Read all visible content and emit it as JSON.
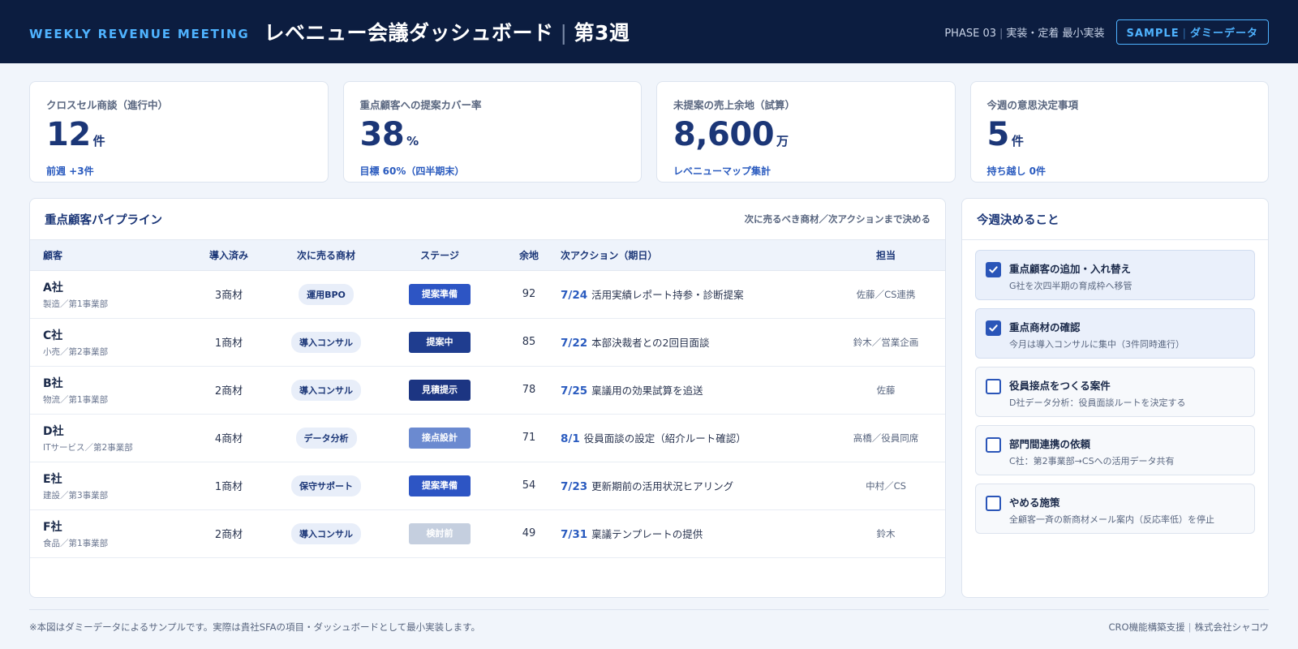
{
  "header": {
    "eyebrow": "WEEKLY REVENUE MEETING",
    "title": "レベニュー会議ダッシュボード",
    "week": "第3週",
    "phase": "PHASE 03",
    "phase_detail": "実装・定着 最小実装",
    "sample_label": "SAMPLE",
    "sample_detail": "ダミーデータ"
  },
  "kpis": [
    {
      "label": "クロスセル商談（進行中）",
      "value": "12",
      "unit": "件",
      "note": "前週 +3件"
    },
    {
      "label": "重点顧客への提案カバー率",
      "value": "38",
      "unit": "%",
      "note": "目標 60%（四半期末）"
    },
    {
      "label": "未提案の売上余地（試算）",
      "value": "8,600",
      "unit": "万",
      "note": "レベニューマップ集計"
    },
    {
      "label": "今週の意思決定事項",
      "value": "5",
      "unit": "件",
      "note": "持ち越し 0件"
    }
  ],
  "pipeline": {
    "title": "重点顧客パイプライン",
    "subtitle": "次に売るべき商材／次アクションまで決める",
    "columns": [
      "顧客",
      "導入済み",
      "次に売る商材",
      "ステージ",
      "余地",
      "次アクション（期日）",
      "担当"
    ],
    "rows": [
      {
        "name": "A社",
        "sub": "製造／第1事業部",
        "installed": "3商材",
        "product": "運用BPO",
        "stage": "提案準備",
        "stage_color": "#2d55c4",
        "score": "92",
        "date": "7/24",
        "action": "活用実績レポート持参・診断提案",
        "owner": "佐藤／CS連携"
      },
      {
        "name": "C社",
        "sub": "小売／第2事業部",
        "installed": "1商材",
        "product": "導入コンサル",
        "stage": "提案中",
        "stage_color": "#1f3d8f",
        "score": "85",
        "date": "7/22",
        "action": "本部決裁者との2回目面談",
        "owner": "鈴木／営業企画"
      },
      {
        "name": "B社",
        "sub": "物流／第1事業部",
        "installed": "2商材",
        "product": "導入コンサル",
        "stage": "見積提示",
        "stage_color": "#1c3582",
        "score": "78",
        "date": "7/25",
        "action": "稟議用の効果試算を追送",
        "owner": "佐藤"
      },
      {
        "name": "D社",
        "sub": "ITサービス／第2事業部",
        "installed": "4商材",
        "product": "データ分析",
        "stage": "接点設計",
        "stage_color": "#6b8ad0",
        "score": "71",
        "date": "8/1",
        "action": "役員面談の設定（紹介ルート確認）",
        "owner": "高橋／役員同席"
      },
      {
        "name": "E社",
        "sub": "建設／第3事業部",
        "installed": "1商材",
        "product": "保守サポート",
        "stage": "提案準備",
        "stage_color": "#2d55c4",
        "score": "54",
        "date": "7/23",
        "action": "更新期前の活用状況ヒアリング",
        "owner": "中村／CS"
      },
      {
        "name": "F社",
        "sub": "食品／第1事業部",
        "installed": "2商材",
        "product": "導入コンサル",
        "stage": "検討前",
        "stage_color": "#c5cfdf",
        "score": "49",
        "date": "7/31",
        "action": "稟議テンプレートの提供",
        "owner": "鈴木"
      }
    ]
  },
  "decisions": {
    "title": "今週決めること",
    "items": [
      {
        "title": "重点顧客の追加・入れ替え",
        "sub": "G社を次四半期の育成枠へ移管",
        "checked": true
      },
      {
        "title": "重点商材の確認",
        "sub": "今月は導入コンサルに集中（3件同時進行）",
        "checked": true
      },
      {
        "title": "役員接点をつくる案件",
        "sub": "D社データ分析：役員面談ルートを決定する",
        "checked": false
      },
      {
        "title": "部門間連携の依頼",
        "sub": "C社：第2事業部→CSへの活用データ共有",
        "checked": false
      },
      {
        "title": "やめる施策",
        "sub": "全顧客一斉の新商材メール案内（反応率低）を停止",
        "checked": false
      }
    ]
  },
  "footer": {
    "note": "※本図はダミーデータによるサンプルです。実際は貴社SFAの項目・ダッシュボードとして最小実装します。",
    "credit_service": "CRO機能構築支援",
    "credit_company": "株式会社シャコウ"
  }
}
